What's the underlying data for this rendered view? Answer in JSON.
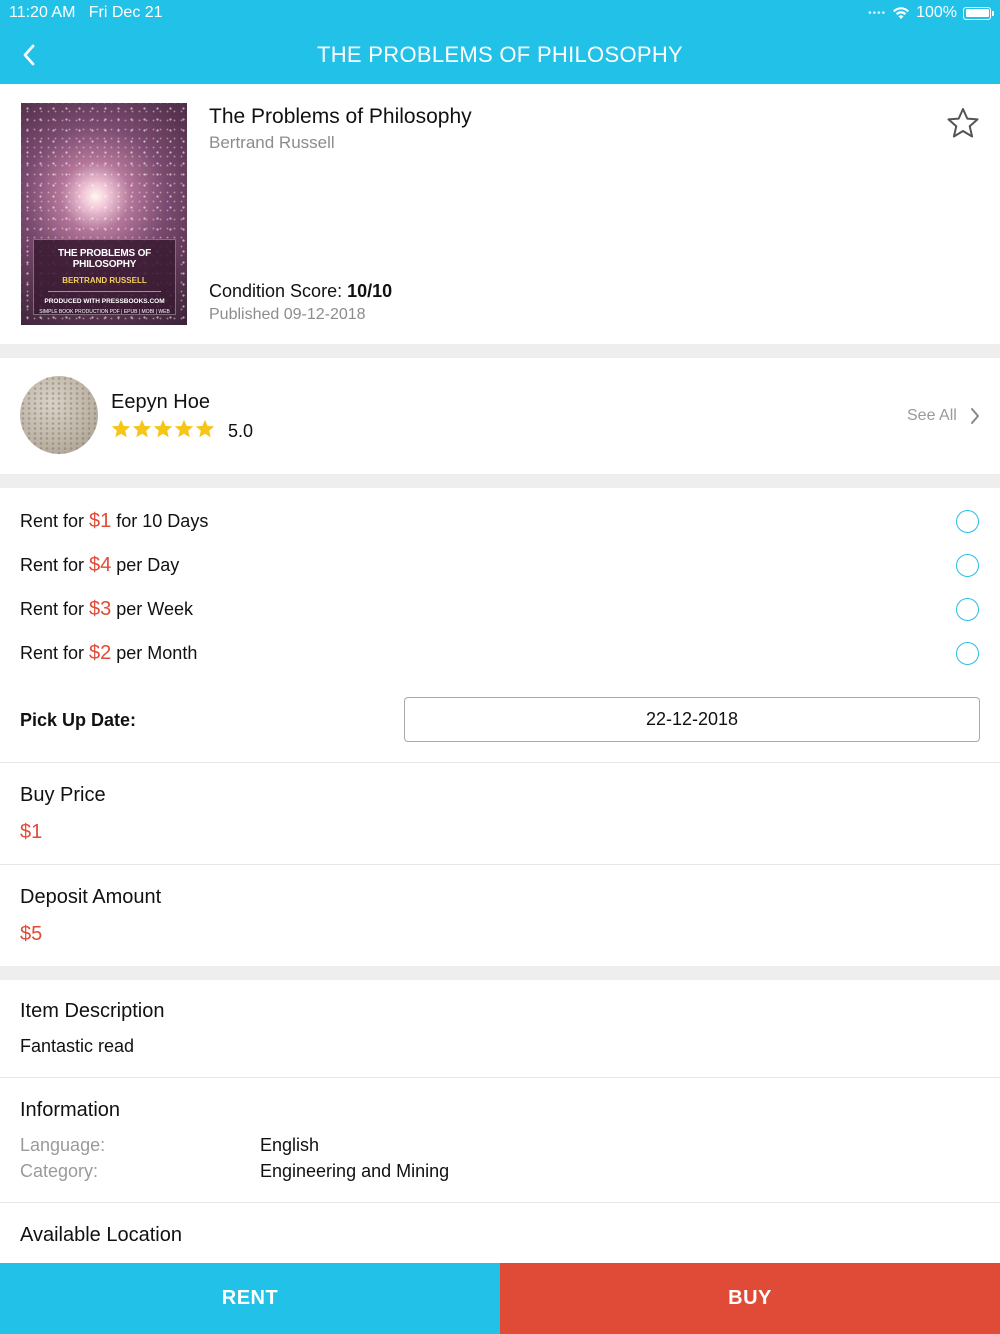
{
  "status_bar": {
    "time": "11:20 AM",
    "date": "Fri Dec 21",
    "battery": "100%",
    "battery_level": 1.0,
    "icons": [
      "signal-dots-icon",
      "wifi-icon",
      "battery-icon"
    ]
  },
  "nav": {
    "title": "THE PROBLEMS OF PHILOSOPHY",
    "back_icon": "chevron-left-icon"
  },
  "book": {
    "title": "The Problems of Philosophy",
    "author": "Bertrand Russell",
    "condition_label": "Condition Score:",
    "condition_value": "10/10",
    "published": "Published 09-12-2018",
    "favorite_icon": "star-outline-icon",
    "cover": {
      "title": "THE PROBLEMS OF PHILOSOPHY",
      "author": "BERTRAND RUSSELL",
      "produced": "PRODUCED WITH PRESSBOOKS.COM",
      "formats": "SIMPLE BOOK PRODUCTION PDF | EPUB | MOBI | WEB"
    }
  },
  "seller": {
    "name": "Eepyn Hoe",
    "rating": "5.0",
    "stars": 5,
    "see_all": "See All"
  },
  "rent_options": [
    {
      "prefix": "Rent for ",
      "price": "$1",
      "suffix": " for 10 Days",
      "selected": false
    },
    {
      "prefix": "Rent for ",
      "price": "$4",
      "suffix": " per Day",
      "selected": false
    },
    {
      "prefix": "Rent for ",
      "price": "$3",
      "suffix": " per Week",
      "selected": false
    },
    {
      "prefix": "Rent for ",
      "price": "$2",
      "suffix": " per Month",
      "selected": false
    }
  ],
  "pickup": {
    "label": "Pick Up Date:",
    "value": "22-12-2018"
  },
  "buy_price": {
    "label": "Buy Price",
    "value": "$1"
  },
  "deposit": {
    "label": "Deposit Amount",
    "value": "$5"
  },
  "description": {
    "label": "Item Description",
    "value": "Fantastic read"
  },
  "information": {
    "label": "Information",
    "language_label": "Language:",
    "language_value": "English",
    "category_label": "Category:",
    "category_value": "Engineering and Mining"
  },
  "location": {
    "label": "Available Location"
  },
  "actions": {
    "rent": "RENT",
    "buy": "BUY"
  },
  "colors": {
    "accent": "#22c1e8",
    "price": "#e04b37",
    "buy": "#df4b36",
    "star": "#f5c518"
  }
}
